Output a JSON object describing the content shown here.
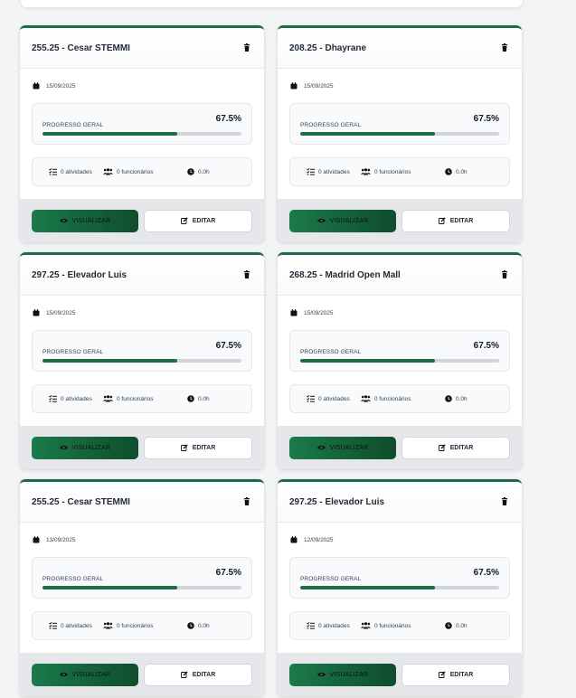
{
  "buttons": {
    "view_label": "VISUALIZAR",
    "edit_label": "EDITAR"
  },
  "progress_label": "PROGRESSO GERAL",
  "cards": [
    {
      "title": "255.25 - Cesar STEMMI",
      "date": "15/09/2025",
      "progress_text": "67.5%",
      "progress": 0.675,
      "activities": "0 atividades",
      "employees": "0 funcionários",
      "hours": "0.0h"
    },
    {
      "title": "208.25 - Dhayrane",
      "date": "15/09/2025",
      "progress_text": "67.5%",
      "progress": 0.675,
      "activities": "0 atividades",
      "employees": "0 funcionários",
      "hours": "0.0h"
    },
    {
      "title": "297.25 - Elevador Luis",
      "date": "15/09/2025",
      "progress_text": "67.5%",
      "progress": 0.675,
      "activities": "0 atividades",
      "employees": "0 funcionários",
      "hours": "0.0h"
    },
    {
      "title": "268.25 - Madrid Open Mall",
      "date": "15/09/2025",
      "progress_text": "67.5%",
      "progress": 0.675,
      "activities": "0 atividades",
      "employees": "0 funcionários",
      "hours": "0.0h"
    },
    {
      "title": "255.25 - Cesar STEMMI",
      "date": "13/09/2025",
      "progress_text": "67.5%",
      "progress": 0.675,
      "activities": "0 atividades",
      "employees": "0 funcionários",
      "hours": "0.0h"
    },
    {
      "title": "297.25 - Elevador Luis",
      "date": "12/09/2025",
      "progress_text": "67.5%",
      "progress": 0.675,
      "activities": "0 atividades",
      "employees": "0 funcionários",
      "hours": "0.0h"
    }
  ],
  "colors": {
    "accent": "#1e6b44",
    "track": "#d1d5db",
    "footer": "#e5e7eb"
  },
  "icons": {
    "trash": "trash-icon",
    "calendar": "calendar-icon",
    "list": "list-icon",
    "users": "users-icon",
    "clock": "clock-icon",
    "eye": "eye-icon",
    "edit": "edit-icon"
  }
}
